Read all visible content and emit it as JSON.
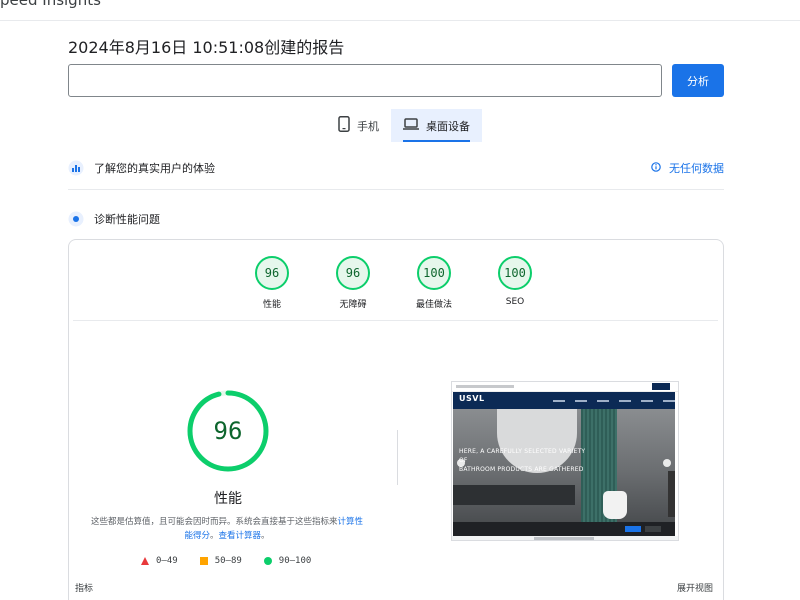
{
  "app": {
    "brand": "peed Insights"
  },
  "report": {
    "title": "2024年8月16日 10:51:08创建的报告"
  },
  "search": {
    "url_value": "",
    "analyze_label": "分析"
  },
  "device_tabs": [
    {
      "label": "手机",
      "icon": "smartphone-icon",
      "active": false
    },
    {
      "label": "桌面设备",
      "icon": "laptop-icon",
      "active": true
    }
  ],
  "field_data": {
    "label": "了解您的真实用户的体验",
    "status": "无任何数据",
    "icon": "users-chart-icon",
    "status_icon": "info-icon"
  },
  "diagnostics": {
    "label": "诊断性能问题",
    "icon": "lighthouse-icon"
  },
  "categories": [
    {
      "label": "性能",
      "score": "96"
    },
    {
      "label": "无障碍",
      "score": "96"
    },
    {
      "label": "最佳做法",
      "score": "100"
    },
    {
      "label": "SEO",
      "score": "100"
    }
  ],
  "performance": {
    "score": 96,
    "score_text": "96",
    "title": "性能",
    "note": "这些都是估算值，且可能会因时而异。系统会直接基于这些指标来",
    "note_link1": "计算性能得分",
    "note_mid": "。",
    "note_link2": "查看计算器",
    "note_end": "。"
  },
  "legend": [
    {
      "range": "0–49",
      "shape": "triangle",
      "color": "#e8393b"
    },
    {
      "range": "50–89",
      "shape": "square",
      "color": "#ffa400"
    },
    {
      "range": "90–100",
      "shape": "circle",
      "color": "#0cce6b"
    }
  ],
  "screenshot": {
    "logo": "USVL",
    "hero_line1": "HERE, A CAREFULLY SELECTED VARIETY OF",
    "hero_line2": "BATHROOM PRODUCTS ARE GATHERED"
  },
  "footer": {
    "metrics_label": "指标",
    "expand_label": "展开视图"
  },
  "colors": {
    "accent": "#1a73e8",
    "pass": "#0cce6b",
    "pass_text": "#0d652d"
  }
}
